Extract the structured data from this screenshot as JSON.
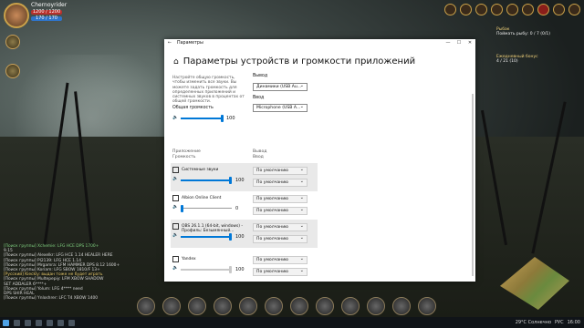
{
  "game": {
    "player_name": "Chernoyrider",
    "hp": "1200 / 1200",
    "energy": "170 / 170",
    "quest_title": "Рыбак",
    "quest_text": "Поймать рыбу: 0 / 7 (0/1)",
    "quest2_title": "Ежедневный бонус",
    "quest2_value": "4 / 21 (10)",
    "chat": [
      {
        "text": "[Поиск группы] Xchemie: LFG HCE DPS 1700+ ",
        "cls": "g"
      },
      {
        "text": "9.15",
        "cls": ""
      },
      {
        "text": "[Поиск группы] Alexelkr: LFG HCE 1.14 HEALER HERE",
        "cls": ""
      },
      {
        "text": "[Поиск группы] Pl2139: LFG HCE 1.14",
        "cls": ""
      },
      {
        "text": "[Поиск группы] Mrgamra: LFM HAMMER DPS 8.12 1600+",
        "cls": ""
      },
      {
        "text": "[Поиск группы] Koriam: LFG SBOW 1810/F 13+",
        "cls": ""
      },
      {
        "text": "[Русский] Kieckly: выдан тоже не будет играть",
        "cls": "y"
      },
      {
        "text": "[Поиск группы] Multepepiy: LFM XBOW SHADOW",
        "cls": ""
      },
      {
        "text": "SET ADDALER 6****+",
        "cls": ""
      },
      {
        "text": "[Поиск группы] Yolum: LFG 4**** need",
        "cls": ""
      },
      {
        "text": "DPS SHIR HEAL",
        "cls": ""
      },
      {
        "text": "[Поиск группы] Ynloshrer: LFC T4 XBOW 1400",
        "cls": ""
      }
    ]
  },
  "window": {
    "title": "Параметры",
    "back_icon": "←",
    "minimize": "—",
    "maximize": "☐",
    "close": "✕",
    "page_title": "Параметры устройств и громкости приложений",
    "description": "Настройте общую громкость, чтобы изменить все звуки. Вы можете задать громкость для определенных приложений и системных звуков в процентах от общей громкости.",
    "master_label": "Общая громкость",
    "master_value": "100",
    "output_label": "Вывод",
    "output_device": "Динамики (USB Au...",
    "input_label": "Ввод",
    "input_device": "Microphone (USB A...",
    "app_col": "Приложение",
    "volume_col": "Громкость",
    "out_col": "Вывод",
    "in_col": "Ввод",
    "apps": [
      {
        "name": "Системные звуки",
        "value": "100",
        "level": 100,
        "out": "По умолчанию",
        "in": "По умолчанию",
        "hi": true,
        "active": true
      },
      {
        "name": "Albion Online Client",
        "value": "0",
        "level": 0,
        "out": "По умолчанию",
        "in": "По умолчанию",
        "hi": false,
        "active": true
      },
      {
        "name": "OBS 26.1.1 (64-bit, windows) - Профиль: Безымянный...",
        "value": "100",
        "level": 100,
        "out": "По умолчанию",
        "in": "По умолчанию",
        "hi": true,
        "active": true
      },
      {
        "name": "Yandex",
        "value": "100",
        "level": 100,
        "out": "По умолчанию",
        "in": "По умолчанию",
        "hi": false,
        "active": false
      }
    ],
    "default_option": "По умолчанию"
  },
  "taskbar": {
    "temperature": "29°C  Солнечно",
    "lang": "РУС",
    "time": "16:00"
  },
  "colors": {
    "accent": "#0078d7",
    "hp": "#b8302c",
    "energy": "#2f74c9"
  }
}
